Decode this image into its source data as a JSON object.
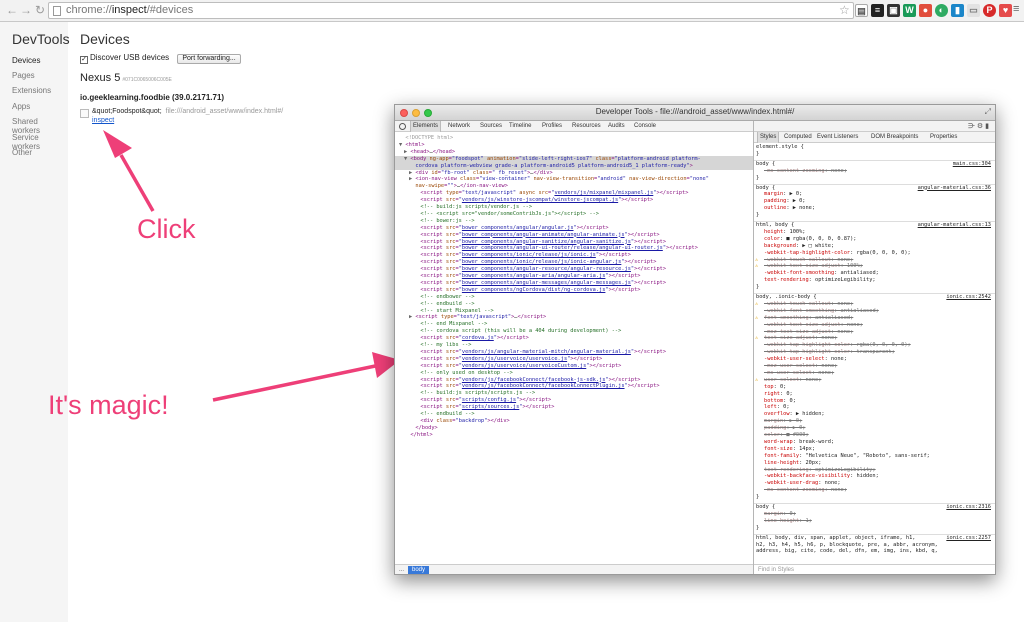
{
  "browser": {
    "url_scheme": "chrome://",
    "url_host": "inspect",
    "url_path": "/#devices",
    "back_icon": "back-arrow-icon",
    "forward_icon": "forward-arrow-icon",
    "reload_icon": "reload-icon"
  },
  "sidebar": {
    "title": "DevTools",
    "items": [
      "Devices",
      "Pages",
      "Extensions",
      "Apps",
      "Shared workers",
      "Service workers",
      "Other"
    ]
  },
  "main": {
    "title": "Devices",
    "usb_checkbox_label": "Discover USB devices",
    "usb_checked": true,
    "port_forwarding_label": "Port forwarding...",
    "device_name": "Nexus 5",
    "device_serial": "#071C0065006C005E",
    "package": "io.geeklearning.foodbie (39.0.2171.71)",
    "page_title": "&quot;Foodspot&quot;",
    "page_url": "file:///android_asset/www/index.html#/",
    "inspect_link": "inspect"
  },
  "annotations": {
    "click": "Click",
    "magic": "It's magic!",
    "color": "#ee3f78"
  },
  "devtools": {
    "window_title": "Developer Tools - file:///android_asset/www/index.html#/",
    "tabs": [
      "Elements",
      "Network",
      "Sources",
      "Timeline",
      "Profiles",
      "Resources",
      "Audits",
      "Console"
    ],
    "active_tab": "Elements",
    "breadcrumb": "body",
    "breadcrumb_dots": "...",
    "styles_tabs": [
      "Styles",
      "Computed",
      "Event Listeners",
      "DOM Breakpoints",
      "Properties"
    ],
    "find_placeholder": "Find in Styles",
    "elements_lines": [
      {
        "indent": 1,
        "tri": "",
        "html": "<span class='dt'>&lt;!DOCTYPE html&gt;</span>"
      },
      {
        "indent": 1,
        "tri": "▼",
        "html": "<span class='tg'>&lt;html&gt;</span>"
      },
      {
        "indent": 2,
        "tri": "▶",
        "html": "<span class='tg'>&lt;head&gt;</span><span class='tx'>…</span><span class='tg'>&lt;/head&gt;</span>"
      },
      {
        "indent": 2,
        "tri": "▼",
        "sel": true,
        "html": "<span class='tg'>&lt;body </span><span class='at'>ng-app</span><span class='tg'>=</span><span class='av'>\"foodspot\"</span> <span class='at'>animation</span><span class='tg'>=</span><span class='av'>\"slide-left-right-ios7\"</span> <span class='at'>class</span><span class='tg'>=</span><span class='av'>\"platform-android platform-</span>"
      },
      {
        "indent": 3,
        "tri": "",
        "sel": true,
        "html": "<span class='av'>cordova platform-webview grade-a platform-android5 platform-android5_1 platform-ready\"</span><span class='tg'>&gt;</span>"
      },
      {
        "indent": 3,
        "tri": "▶",
        "html": "<span class='tg'>&lt;div </span><span class='at'>id</span><span class='tg'>=</span><span class='av'>\"fb-root\"</span> <span class='at'>class</span><span class='tg'>=</span><span class='av'>\" fb_reset\"</span><span class='tg'>&gt;</span><span class='tx'>…</span><span class='tg'>&lt;/div&gt;</span>"
      },
      {
        "indent": 3,
        "tri": "▶",
        "html": "<span class='tg'>&lt;ion-nav-view </span><span class='at'>class</span><span class='tg'>=</span><span class='av'>\"view-container\"</span> <span class='at'>nav-view-transition</span><span class='tg'>=</span><span class='av'>\"android\"</span> <span class='at'>nav-view-direction</span><span class='tg'>=</span><span class='av'>\"none\"</span>"
      },
      {
        "indent": 3,
        "tri": "",
        "html": "<span class='at'>nav-swipe</span><span class='tg'>=</span><span class='av'>\"\"</span><span class='tg'>&gt;</span><span class='tx'>…</span><span class='tg'>&lt;/ion-nav-view&gt;</span>"
      },
      {
        "indent": 4,
        "tri": "",
        "html": "<span class='tg'>&lt;script </span><span class='at'>type</span><span class='tg'>=</span><span class='av'>\"text/javascript\"</span> <span class='at'>async</span> <span class='at'>src</span><span class='tg'>=</span><span class='av'>\"</span><a>vendors/js/mixpanel/mixpanel.js</a><span class='av'>\"</span><span class='tg'>&gt;&lt;/script&gt;</span>"
      },
      {
        "indent": 4,
        "tri": "",
        "html": "<span class='tg'>&lt;script </span><span class='at'>src</span><span class='tg'>=</span><span class='av'>\"</span><a>vendors/js/winstore-jscompat/winstore-jscompat.js</a><span class='av'>\"</span><span class='tg'>&gt;&lt;/script&gt;</span>"
      },
      {
        "indent": 4,
        "tri": "",
        "html": "<span class='cm'>&lt;!-- build:js scripts/vendor.js --&gt;</span>"
      },
      {
        "indent": 4,
        "tri": "",
        "html": "<span class='cm'>&lt;!-- &lt;script src=\"vendor/someContribJs.js\"&gt;&lt;/script&gt; --&gt;</span>"
      },
      {
        "indent": 4,
        "tri": "",
        "html": "<span class='cm'>&lt;!-- bower:js --&gt;</span>"
      },
      {
        "indent": 4,
        "tri": "",
        "html": "<span class='tg'>&lt;script </span><span class='at'>src</span><span class='tg'>=</span><span class='av'>\"</span><a>bower_components/angular/angular.js</a><span class='av'>\"</span><span class='tg'>&gt;&lt;/script&gt;</span>"
      },
      {
        "indent": 4,
        "tri": "",
        "html": "<span class='tg'>&lt;script </span><span class='at'>src</span><span class='tg'>=</span><span class='av'>\"</span><a>bower_components/angular-animate/angular-animate.js</a><span class='av'>\"</span><span class='tg'>&gt;&lt;/script&gt;</span>"
      },
      {
        "indent": 4,
        "tri": "",
        "html": "<span class='tg'>&lt;script </span><span class='at'>src</span><span class='tg'>=</span><span class='av'>\"</span><a>bower_components/angular-sanitize/angular-sanitize.js</a><span class='av'>\"</span><span class='tg'>&gt;&lt;/script&gt;</span>"
      },
      {
        "indent": 4,
        "tri": "",
        "html": "<span class='tg'>&lt;script </span><span class='at'>src</span><span class='tg'>=</span><span class='av'>\"</span><a>bower_components/angular-ui-router/release/angular-ui-router.js</a><span class='av'>\"</span><span class='tg'>&gt;&lt;/script&gt;</span>"
      },
      {
        "indent": 4,
        "tri": "",
        "html": "<span class='tg'>&lt;script </span><span class='at'>src</span><span class='tg'>=</span><span class='av'>\"</span><a>bower_components/ionic/release/js/ionic.js</a><span class='av'>\"</span><span class='tg'>&gt;&lt;/script&gt;</span>"
      },
      {
        "indent": 4,
        "tri": "",
        "html": "<span class='tg'>&lt;script </span><span class='at'>src</span><span class='tg'>=</span><span class='av'>\"</span><a>bower_components/ionic/release/js/ionic-angular.js</a><span class='av'>\"</span><span class='tg'>&gt;&lt;/script&gt;</span>"
      },
      {
        "indent": 4,
        "tri": "",
        "html": "<span class='tg'>&lt;script </span><span class='at'>src</span><span class='tg'>=</span><span class='av'>\"</span><a>bower_components/angular-resource/angular-resource.js</a><span class='av'>\"</span><span class='tg'>&gt;&lt;/script&gt;</span>"
      },
      {
        "indent": 4,
        "tri": "",
        "html": "<span class='tg'>&lt;script </span><span class='at'>src</span><span class='tg'>=</span><span class='av'>\"</span><a>bower_components/angular-aria/angular-aria.js</a><span class='av'>\"</span><span class='tg'>&gt;&lt;/script&gt;</span>"
      },
      {
        "indent": 4,
        "tri": "",
        "html": "<span class='tg'>&lt;script </span><span class='at'>src</span><span class='tg'>=</span><span class='av'>\"</span><a>bower_components/angular-messages/angular-messages.js</a><span class='av'>\"</span><span class='tg'>&gt;&lt;/script&gt;</span>"
      },
      {
        "indent": 4,
        "tri": "",
        "html": "<span class='tg'>&lt;script </span><span class='at'>src</span><span class='tg'>=</span><span class='av'>\"</span><a>bower_components/ngCordova/dist/ng-cordova.js</a><span class='av'>\"</span><span class='tg'>&gt;&lt;/script&gt;</span>"
      },
      {
        "indent": 4,
        "tri": "",
        "html": "<span class='cm'>&lt;!-- endbower --&gt;</span>"
      },
      {
        "indent": 4,
        "tri": "",
        "html": "<span class='cm'>&lt;!-- endbuild --&gt;</span>"
      },
      {
        "indent": 4,
        "tri": "",
        "html": "<span class='cm'>&lt;!-- start Mixpanel --&gt;</span>"
      },
      {
        "indent": 3,
        "tri": "▶",
        "html": "<span class='tg'>&lt;script </span><span class='at'>type</span><span class='tg'>=</span><span class='av'>\"text/javascript\"</span><span class='tg'>&gt;</span><span class='tx'>…</span><span class='tg'>&lt;/script&gt;</span>"
      },
      {
        "indent": 4,
        "tri": "",
        "html": "<span class='cm'>&lt;!-- end Mixpanel --&gt;</span>"
      },
      {
        "indent": 4,
        "tri": "",
        "html": "<span class='cm'>&lt;!-- cordova script (this will be a 404 during development) --&gt;</span>"
      },
      {
        "indent": 4,
        "tri": "",
        "html": "<span class='tg'>&lt;script </span><span class='at'>src</span><span class='tg'>=</span><span class='av'>\"</span><a>cordova.js</a><span class='av'>\"</span><span class='tg'>&gt;&lt;/script&gt;</span>"
      },
      {
        "indent": 4,
        "tri": "",
        "html": "<span class='cm'>&lt;!-- my libs --&gt;</span>"
      },
      {
        "indent": 4,
        "tri": "",
        "html": "<span class='tg'>&lt;script </span><span class='at'>src</span><span class='tg'>=</span><span class='av'>\"</span><a>vendors/js/angular-material-mitch/angular-material.js</a><span class='av'>\"</span><span class='tg'>&gt;&lt;/script&gt;</span>"
      },
      {
        "indent": 4,
        "tri": "",
        "html": "<span class='tg'>&lt;script </span><span class='at'>src</span><span class='tg'>=</span><span class='av'>\"</span><a>vendors/js/uservoice/uservoice.js</a><span class='av'>\"</span><span class='tg'>&gt;&lt;/script&gt;</span>"
      },
      {
        "indent": 4,
        "tri": "",
        "html": "<span class='tg'>&lt;script </span><span class='at'>src</span><span class='tg'>=</span><span class='av'>\"</span><a>vendors/js/uservoice/uservoiceCustom.js</a><span class='av'>\"</span><span class='tg'>&gt;&lt;/script&gt;</span>"
      },
      {
        "indent": 4,
        "tri": "",
        "html": "<span class='cm'>&lt;!-- only used on desktop --&gt;</span>"
      },
      {
        "indent": 4,
        "tri": "",
        "html": "<span class='tg'>&lt;script </span><span class='at'>src</span><span class='tg'>=</span><span class='av'>\"</span><a>vendors/js/facebookConnect/facebook-js-sdk.js</a><span class='av'>\"</span><span class='tg'>&gt;&lt;/script&gt;</span>"
      },
      {
        "indent": 4,
        "tri": "",
        "html": "<span class='tg'>&lt;script </span><span class='at'>src</span><span class='tg'>=</span><span class='av'>\"</span><a>vendors/js/facebookConnect/facebookConnectPlugin.js</a><span class='av'>\"</span><span class='tg'>&gt;&lt;/script&gt;</span>"
      },
      {
        "indent": 4,
        "tri": "",
        "html": "<span class='cm'>&lt;!-- build:js scripts/scripts.js --&gt;</span>"
      },
      {
        "indent": 4,
        "tri": "",
        "html": "<span class='tg'>&lt;script </span><span class='at'>src</span><span class='tg'>=</span><span class='av'>\"</span><a>scripts/config.js</a><span class='av'>\"</span><span class='tg'>&gt;&lt;/script&gt;</span>"
      },
      {
        "indent": 4,
        "tri": "",
        "html": "<span class='tg'>&lt;script </span><span class='at'>src</span><span class='tg'>=</span><span class='av'>\"</span><a>scripts/sources.js</a><span class='av'>\"</span><span class='tg'>&gt;&lt;/script&gt;</span>"
      },
      {
        "indent": 4,
        "tri": "",
        "html": "<span class='cm'>&lt;!-- endbuild --&gt;</span>"
      },
      {
        "indent": 4,
        "tri": "",
        "html": "<span class='tg'>&lt;div </span><span class='at'>class</span><span class='tg'>=</span><span class='av'>\"backdrop\"</span><span class='tg'>&gt;&lt;/div&gt;</span>"
      },
      {
        "indent": 3,
        "tri": "",
        "html": "<span class='tg'>&lt;/body&gt;</span>"
      },
      {
        "indent": 2,
        "tri": "",
        "html": "<span class='tg'>&lt;/html&gt;</span>"
      }
    ],
    "styles_lines": [
      {
        "t": "rule",
        "text": "element.style {"
      },
      {
        "t": "plain",
        "text": "}"
      },
      {
        "t": "hr"
      },
      {
        "t": "rule",
        "text": "body {",
        "src": "main.css:304"
      },
      {
        "t": "prop",
        "strike": true,
        "name": "-ms-content-zooming",
        "val": "none;"
      },
      {
        "t": "plain",
        "text": "}"
      },
      {
        "t": "hr"
      },
      {
        "t": "rule",
        "text": "body {",
        "src": "angular-material.css:36"
      },
      {
        "t": "prop",
        "name": "margin",
        "val": "▶ 0;"
      },
      {
        "t": "prop",
        "name": "padding",
        "val": "▶ 0;"
      },
      {
        "t": "prop",
        "name": "outline",
        "val": "▶ none;"
      },
      {
        "t": "plain",
        "text": "}"
      },
      {
        "t": "hr"
      },
      {
        "t": "rule",
        "text": "html, body {",
        "src": "angular-material.css:13"
      },
      {
        "t": "prop",
        "name": "height",
        "val": "100%;"
      },
      {
        "t": "prop",
        "name": "color",
        "val": "■ rgba(0, 0, 0, 0.87);"
      },
      {
        "t": "prop",
        "name": "background",
        "val": "▶ □ white;"
      },
      {
        "t": "prop",
        "name": "-webkit-tap-highlight-color",
        "val": "rgba(0, 0, 0, 0);"
      },
      {
        "t": "prop",
        "warn": true,
        "strike": true,
        "name": "-webkit-touch-callout",
        "val": "none;"
      },
      {
        "t": "prop",
        "warn": true,
        "strike": true,
        "name": "-webkit-text-size-adjust",
        "val": "100%;"
      },
      {
        "t": "prop",
        "name": "-webkit-font-smoothing",
        "val": "antialiased;"
      },
      {
        "t": "prop",
        "name": "text-rendering",
        "val": "optimizeLegibility;"
      },
      {
        "t": "plain",
        "text": "}"
      },
      {
        "t": "hr"
      },
      {
        "t": "rule",
        "text": "body, .ionic-body {",
        "src": "ionic.css:2542"
      },
      {
        "t": "prop",
        "warn": true,
        "strike": true,
        "name": "-webkit-touch-callout",
        "val": "none;"
      },
      {
        "t": "prop",
        "strike": true,
        "name": "-webkit-font-smoothing",
        "val": "antialiased;"
      },
      {
        "t": "prop",
        "warn": true,
        "strike": true,
        "name": "font-smoothing",
        "val": "antialiased;"
      },
      {
        "t": "prop",
        "strike": true,
        "name": "-webkit-text-size-adjust",
        "val": "none;"
      },
      {
        "t": "prop",
        "strike": true,
        "name": "-moz-text-size-adjust",
        "val": "none;"
      },
      {
        "t": "prop",
        "warn": true,
        "strike": true,
        "name": "text-size-adjust",
        "val": "none;"
      },
      {
        "t": "prop",
        "strike": true,
        "name": "-webkit-tap-highlight-color",
        "val": "rgba(0, 0, 0, 0);"
      },
      {
        "t": "prop",
        "strike": true,
        "name": "-webkit-tap-highlight-color",
        "val": "transparent;"
      },
      {
        "t": "prop",
        "name": "-webkit-user-select",
        "val": "none;"
      },
      {
        "t": "prop",
        "strike": true,
        "name": "-moz-user-select",
        "val": "none;"
      },
      {
        "t": "prop",
        "strike": true,
        "name": "-ms-user-select",
        "val": "none;"
      },
      {
        "t": "prop",
        "warn": true,
        "strike": true,
        "name": "user-select",
        "val": "none;"
      },
      {
        "t": "prop",
        "name": "top",
        "val": "0;"
      },
      {
        "t": "prop",
        "name": "right",
        "val": "0;"
      },
      {
        "t": "prop",
        "name": "bottom",
        "val": "0;"
      },
      {
        "t": "prop",
        "name": "left",
        "val": "0;"
      },
      {
        "t": "prop",
        "name": "overflow",
        "val": "▶ hidden;"
      },
      {
        "t": "prop",
        "strike": true,
        "name": "margin",
        "val": "▶ 0;"
      },
      {
        "t": "prop",
        "strike": true,
        "name": "padding",
        "val": "▶ 0;"
      },
      {
        "t": "prop",
        "strike": true,
        "name": "color",
        "val": "■ #000;"
      },
      {
        "t": "prop",
        "name": "word-wrap",
        "val": "break-word;"
      },
      {
        "t": "prop",
        "name": "font-size",
        "val": "14px;"
      },
      {
        "t": "prop",
        "name": "font-family",
        "val": "\"Helvetica Neue\", \"Roboto\", sans-serif;"
      },
      {
        "t": "prop",
        "name": "line-height",
        "val": "20px;"
      },
      {
        "t": "prop",
        "strike": true,
        "name": "text-rendering",
        "val": "optimizeLegibility;"
      },
      {
        "t": "prop",
        "name": "-webkit-backface-visibility",
        "val": "hidden;"
      },
      {
        "t": "prop",
        "name": "-webkit-user-drag",
        "val": "none;"
      },
      {
        "t": "prop",
        "strike": true,
        "name": "-ms-content-zooming",
        "val": "none;"
      },
      {
        "t": "plain",
        "text": "}"
      },
      {
        "t": "hr"
      },
      {
        "t": "rule",
        "text": "body {",
        "src": "ionic.css:2316"
      },
      {
        "t": "prop",
        "strike": true,
        "name": "margin",
        "val": "0;"
      },
      {
        "t": "prop",
        "strike": true,
        "name": "line-height",
        "val": "1;"
      },
      {
        "t": "plain",
        "text": "}"
      },
      {
        "t": "hr"
      },
      {
        "t": "rule",
        "text": "html, body, div, span, applet, object, iframe, h1,",
        "src": "ionic.css:2257"
      },
      {
        "t": "plain",
        "text": "h2, h3, h4, h5, h6, p, blockquote, pre, a, abbr, acronym,"
      },
      {
        "t": "plain",
        "text": "address, big, cite, code, del, dfn, em, img, ins, kbd, q,"
      }
    ]
  }
}
